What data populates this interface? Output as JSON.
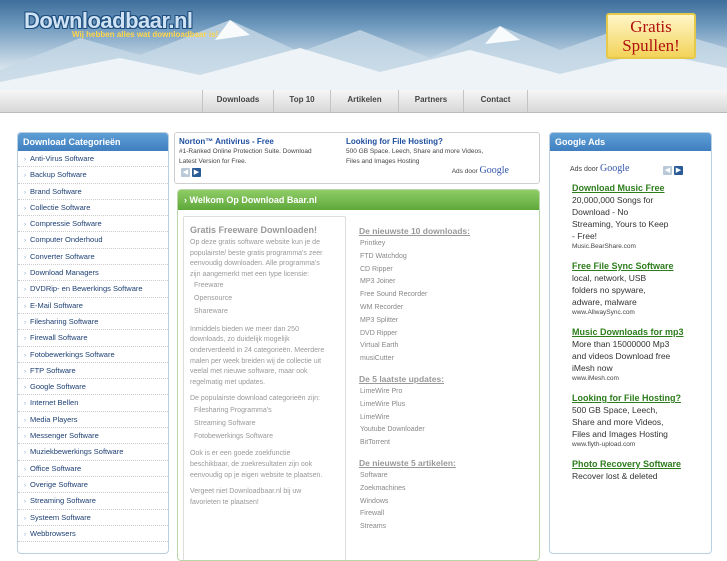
{
  "header": {
    "logo": "Downloadbaar.nl",
    "tagline": "Wij hebben alles wat downloadbaar is!",
    "promo_line1": "Gratis",
    "promo_line2": "Spullen!"
  },
  "nav": [
    {
      "label": "Downloads"
    },
    {
      "label": "Top 10"
    },
    {
      "label": "Artikelen"
    },
    {
      "label": "Partners"
    },
    {
      "label": "Contact"
    }
  ],
  "left_panel": {
    "title": "Download Categorieën",
    "items": [
      "Anti-Virus Software",
      "Backup Software",
      "Brand Software",
      "Collectie Software",
      "Compressie Software",
      "Computer Onderhoud",
      "Converter Software",
      "Download Managers",
      "DVDRip- en Bewerkings Software",
      "E-Mail Software",
      "Filesharing Software",
      "Firewall Software",
      "Fotobewerkings Software",
      "FTP Software",
      "Google Software",
      "Internet Bellen",
      "Media Players",
      "Messenger Software",
      "Muziekbewerkings Software",
      "Office Software",
      "Overige Software",
      "Streaming Software",
      "Systeem Software",
      "Webbrowsers"
    ]
  },
  "top_ads": {
    "ad1_title": "Norton™ Antivirus - Free",
    "ad1_desc1": "#1-Ranked Online Protection Suite. Download",
    "ad1_desc2": "Latest Version for Free.",
    "ad2_title": "Looking for File Hosting?",
    "ad2_desc1": "500 GB Space. Leech, Share and more Videos,",
    "ad2_desc2": "Files and Images Hosting",
    "ads_by": "Ads door",
    "google": "Google"
  },
  "main": {
    "title": "Welkom Op Download Baar.nl",
    "left": {
      "heading": "Gratis Freeware Downloaden!",
      "para1": [
        "Op deze gratis software website kun je de",
        "populairste/ beste gratis programma's zeer",
        "eenvoudig downloaden. Alle programma's",
        "zijn aangemerkt met een type licensie:"
      ],
      "licenses": [
        "Freeware",
        "Opensource",
        "Shareware"
      ],
      "para2": [
        "Inmiddels bieden we meer dan 250",
        "downloads, zo duidelijk mogelijk",
        "onderverdeeld in 24 categorieën. Meerdere",
        "malen per week breiden wij de collectie uit",
        "veelal met nieuwe software, maar ook",
        "regelmatig met updates."
      ],
      "para3": [
        "De populairste download categorieën zijn:"
      ],
      "popular": [
        "Filesharing Programma's",
        "Streaming Software",
        "Fotobewerkings Software"
      ],
      "para4": [
        "Ook is er een goede zoekfunctie",
        "beschikbaar, de zoekresultaten zijn ook",
        "eenvoudig op je eigen website te plaatsen."
      ],
      "para5": [
        "Vergeet niet Downloadbaar.nl bij uw",
        "favorieten te plaatsen!"
      ]
    },
    "right": {
      "newest_heading": "De nieuwste 10 downloads:",
      "newest": [
        "Printkey",
        "FTD Watchdog",
        "CD Ripper",
        "MP3 Joiner",
        "Free Sound Recorder",
        "WM Recorder",
        "MP3 Splitter",
        "DVD Ripper",
        "Virtual Earth",
        "musiCutter"
      ],
      "updates_heading": "De 5 laatste updates:",
      "updates": [
        "LimeWire Pro",
        "LimeWire Plus",
        "LimeWire",
        "Youtube Downloader",
        "BitTorrent"
      ],
      "articles_heading": "De nieuwste 5 artikelen:",
      "articles": [
        "Software",
        "Zoekmachines",
        "Windows",
        "Firewall",
        "Streams"
      ]
    }
  },
  "right_panel": {
    "title": "Google Ads",
    "ads_by": "Ads door",
    "google": "Google",
    "ads": [
      {
        "title": "Download Music Free",
        "desc": [
          "20,000,000 Songs for",
          "Download - No",
          "Streaming, Yours to Keep",
          "- Free!"
        ],
        "url": "Music.BearShare.com"
      },
      {
        "title": "Free File Sync Software",
        "desc": [
          "local, network, USB",
          "folders no spyware,",
          "adware, malware"
        ],
        "url": "www.AllwaySync.com"
      },
      {
        "title": "Music Downloads for mp3",
        "desc": [
          "More than 15000000 Mp3",
          "and videos Download free",
          "iMesh now"
        ],
        "url": "www.iMesh.com"
      },
      {
        "title": "Looking for File Hosting?",
        "desc": [
          "500 GB Space, Leech,",
          "Share and more Videos,",
          "Files and Images Hosting"
        ],
        "url": "www.flyth-upload.com"
      },
      {
        "title": "Photo Recovery Software",
        "desc": [
          "Recover lost & deleted"
        ],
        "url": ""
      }
    ]
  },
  "colors": {
    "accent_blue": "#3f7fbf",
    "accent_green": "#5ea83a",
    "ad_title_green": "#2d7d1c"
  }
}
